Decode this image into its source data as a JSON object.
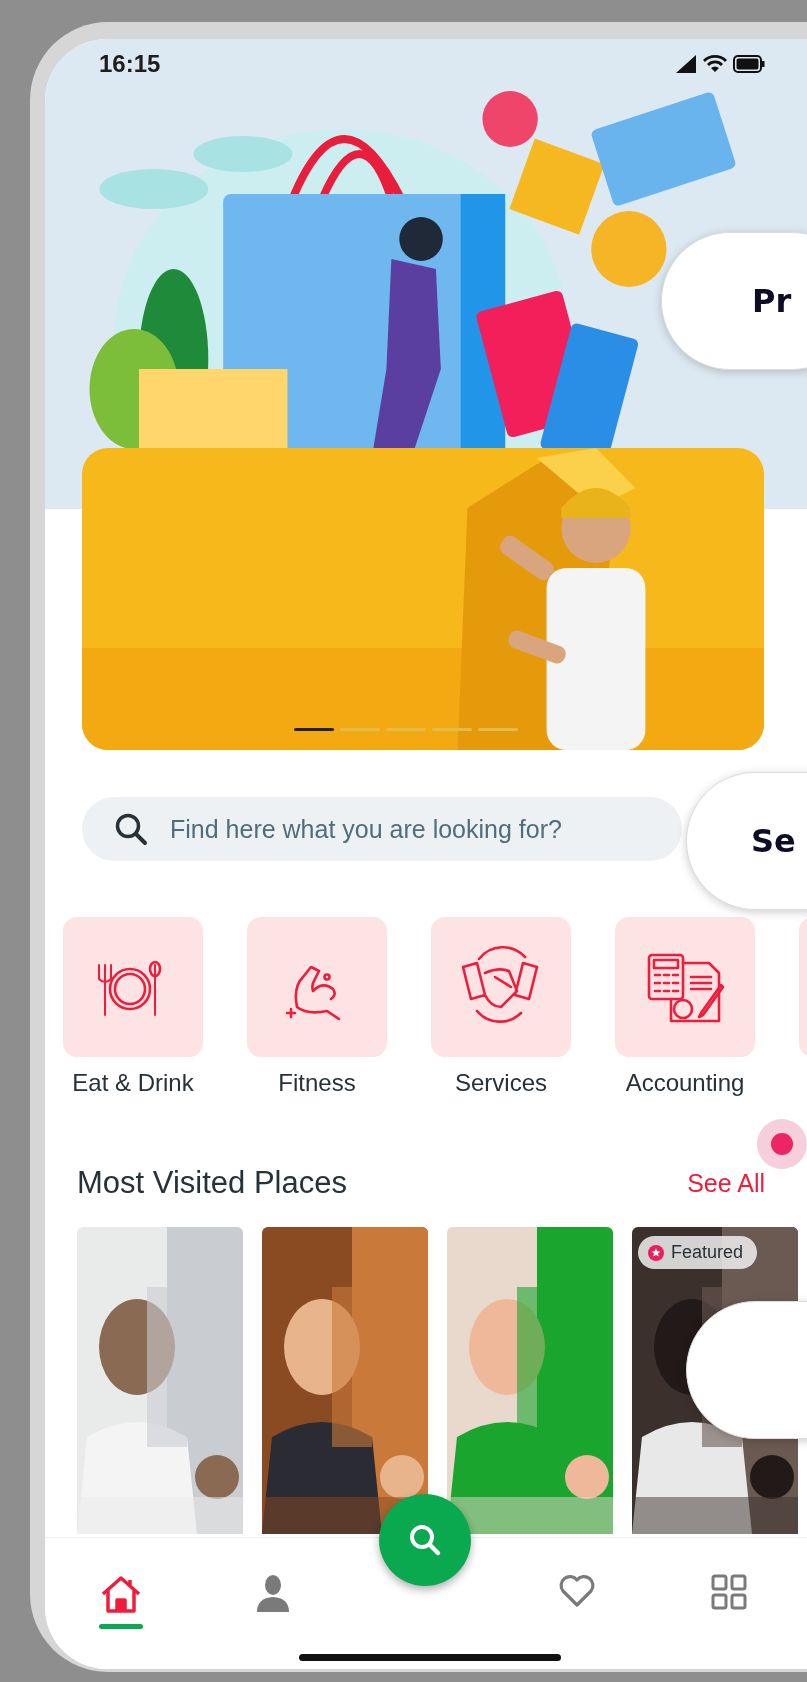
{
  "status_bar": {
    "time": "16:15"
  },
  "banner": {
    "slides": [
      {
        "selected": true
      },
      {
        "selected": false
      },
      {
        "selected": false
      },
      {
        "selected": false
      },
      {
        "selected": false
      }
    ]
  },
  "search": {
    "placeholder": "Find here what you are looking for?"
  },
  "categories": [
    {
      "kind": "dining",
      "label": "Eat & Drink"
    },
    {
      "kind": "fitness",
      "label": "Fitness"
    },
    {
      "kind": "handshake",
      "label": "Services"
    },
    {
      "kind": "accounting",
      "label": "Accounting"
    },
    {
      "kind": "partial"
    }
  ],
  "most_visited": {
    "title": "Most Visited Places",
    "see_all": "See All",
    "places": [
      {
        "kind": "doctor"
      },
      {
        "kind": "lawyer"
      },
      {
        "kind": "medical"
      },
      {
        "kind": "dark",
        "badge": "Featured"
      }
    ]
  },
  "bottom_nav": {
    "items": [
      {
        "kind": "home",
        "selected": true
      },
      {
        "kind": "profile",
        "selected": false
      },
      {
        "kind": "search_fab",
        "selected": false
      },
      {
        "kind": "favorites",
        "selected": false
      },
      {
        "kind": "grid",
        "selected": false
      }
    ]
  },
  "floating_buttons": [
    {
      "kind": "label",
      "label": "Pr"
    },
    {
      "kind": "label",
      "label": "Se"
    },
    {
      "kind": "blank"
    }
  ]
}
